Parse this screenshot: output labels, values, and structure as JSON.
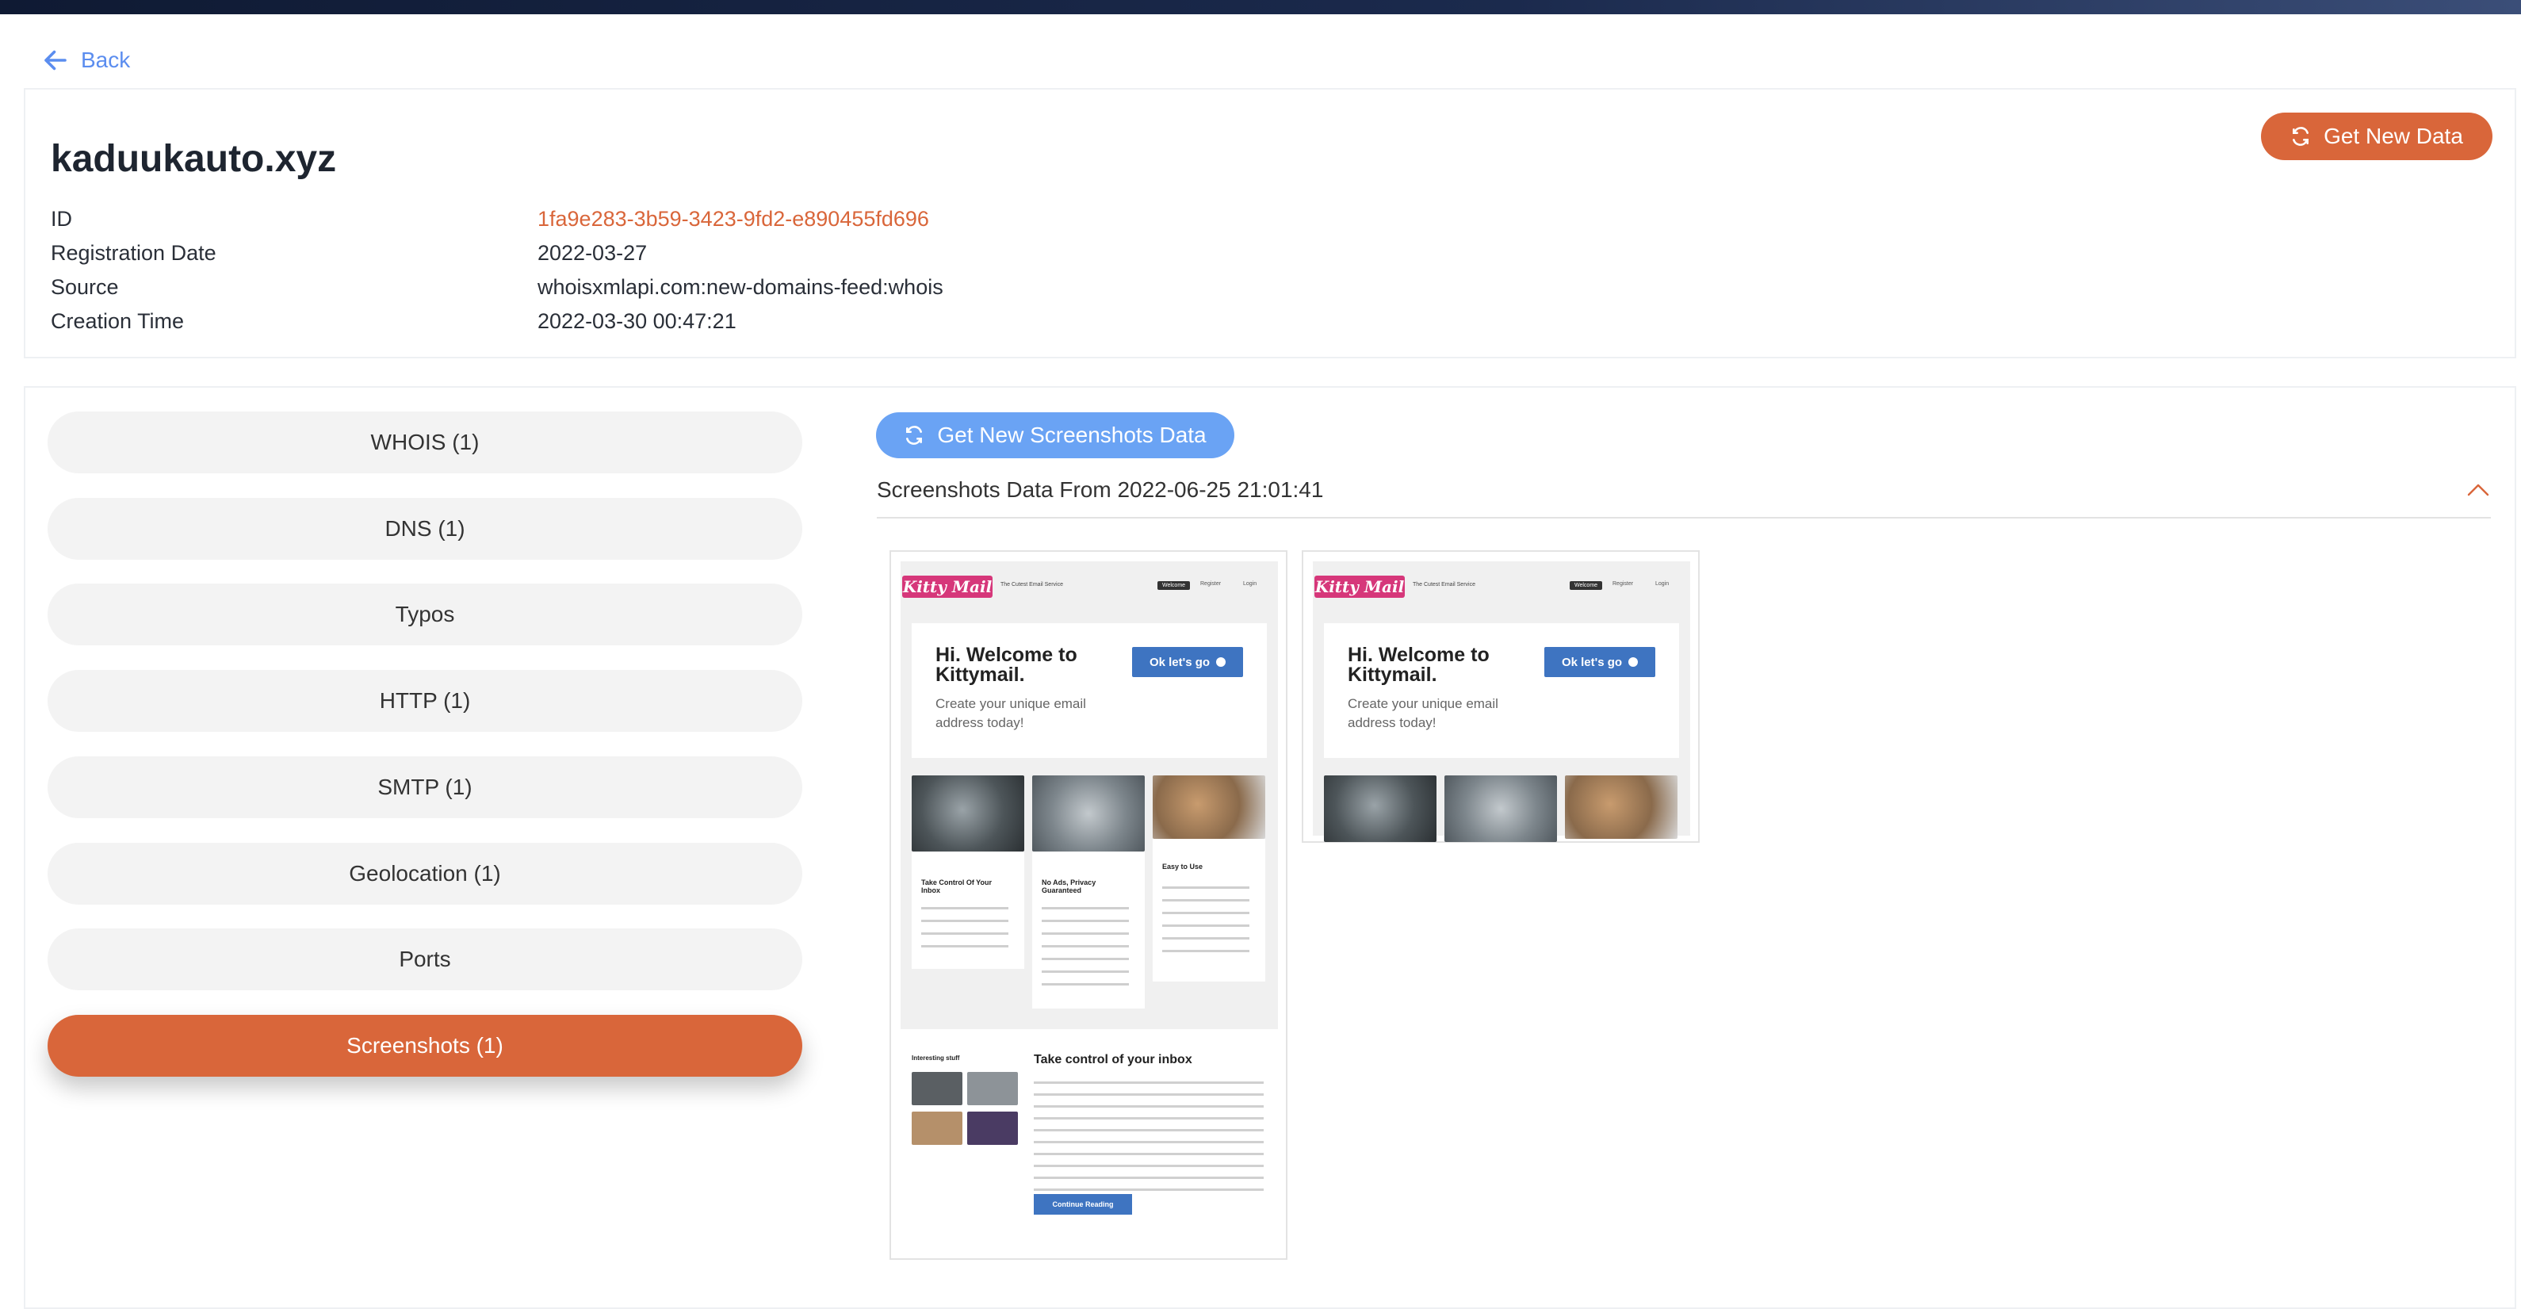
{
  "nav": {
    "back_label": "Back"
  },
  "domain": {
    "name": "kaduukauto.xyz",
    "get_new_data_label": "Get New Data",
    "fields": [
      {
        "label": "ID",
        "value": "1fa9e283-3b59-3423-9fd2-e890455fd696"
      },
      {
        "label": "Registration Date",
        "value": "2022-03-27"
      },
      {
        "label": "Source",
        "value": "whoisxmlapi.com:new-domains-feed:whois"
      },
      {
        "label": "Creation Time",
        "value": "2022-03-30 00:47:21"
      }
    ]
  },
  "tabs": [
    {
      "label": "WHOIS (1)",
      "active": false
    },
    {
      "label": "DNS (1)",
      "active": false
    },
    {
      "label": "Typos",
      "active": false
    },
    {
      "label": "HTTP (1)",
      "active": false
    },
    {
      "label": "SMTP (1)",
      "active": false
    },
    {
      "label": "Geolocation (1)",
      "active": false
    },
    {
      "label": "Ports",
      "active": false
    },
    {
      "label": "Screenshots (1)",
      "active": true
    }
  ],
  "screenshots": {
    "get_new_label": "Get New Screenshots Data",
    "header": "Screenshots Data From 2022-06-25 21:01:41",
    "site": {
      "logo": "Kitty Mail",
      "tagline": "The Cutest Email Service",
      "nav": [
        "Welcome",
        "Register",
        "Login"
      ],
      "hero_title": "Hi. Welcome to Kittymail.",
      "hero_sub": "Create your unique email address today!",
      "cta": "Ok let's go",
      "features": [
        "Take Control Of Your Inbox",
        "No Ads, Privacy Guaranteed",
        "Easy to Use"
      ],
      "interesting": "Interesting stuff",
      "section_title": "Take control of your inbox",
      "continue": "Continue Reading"
    }
  },
  "colors": {
    "accent": "#d9663a",
    "primary_blue": "#6aa3f4",
    "link": "#5b8def"
  }
}
